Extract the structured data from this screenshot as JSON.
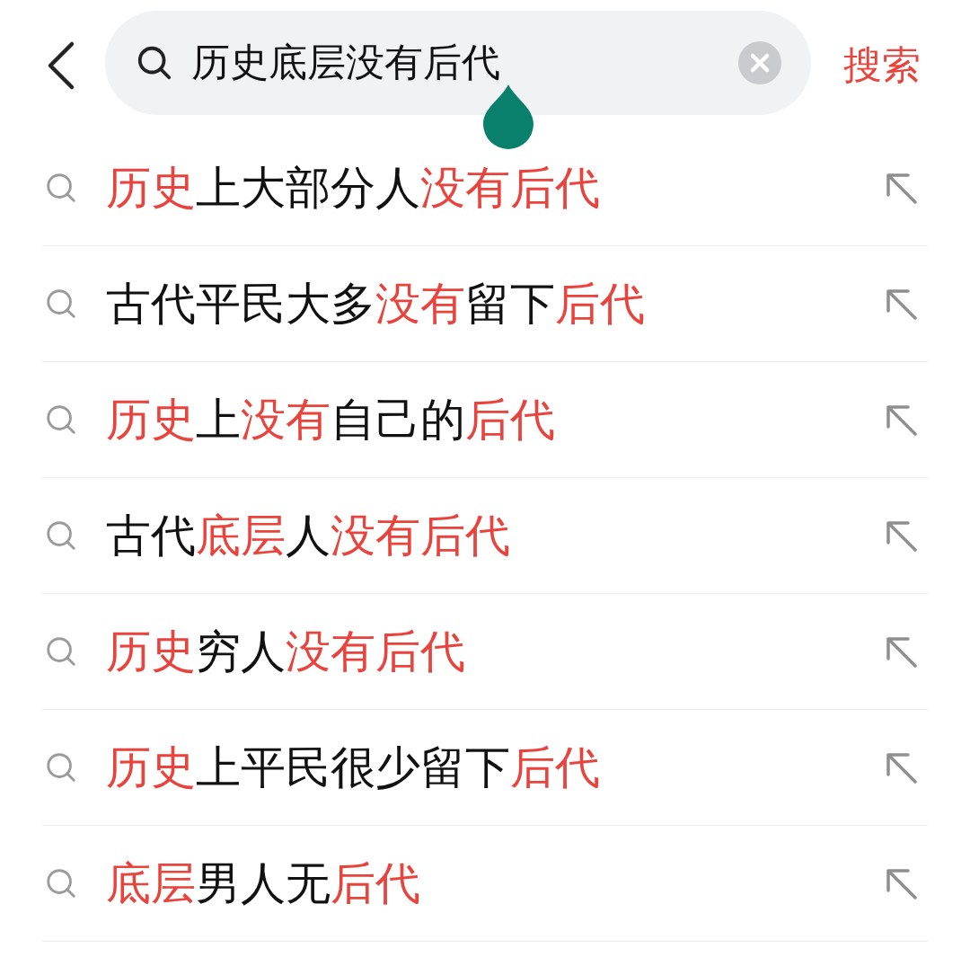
{
  "search": {
    "value": "历史底层没有后代",
    "submit": "搜索"
  },
  "suggestions": [
    {
      "segments": [
        {
          "text": "历史",
          "highlight": true
        },
        {
          "text": "上大部分人",
          "highlight": false
        },
        {
          "text": "没有后代",
          "highlight": true
        }
      ]
    },
    {
      "segments": [
        {
          "text": "古代平民大多",
          "highlight": false
        },
        {
          "text": "没有",
          "highlight": true
        },
        {
          "text": "留下",
          "highlight": false
        },
        {
          "text": "后代",
          "highlight": true
        }
      ]
    },
    {
      "segments": [
        {
          "text": "历史",
          "highlight": true
        },
        {
          "text": "上",
          "highlight": false
        },
        {
          "text": "没有",
          "highlight": true
        },
        {
          "text": "自己的",
          "highlight": false
        },
        {
          "text": "后代",
          "highlight": true
        }
      ]
    },
    {
      "segments": [
        {
          "text": "古代",
          "highlight": false
        },
        {
          "text": "底层",
          "highlight": true
        },
        {
          "text": "人",
          "highlight": false
        },
        {
          "text": "没有后代",
          "highlight": true
        }
      ]
    },
    {
      "segments": [
        {
          "text": "历史",
          "highlight": true
        },
        {
          "text": "穷人",
          "highlight": false
        },
        {
          "text": "没有后代",
          "highlight": true
        }
      ]
    },
    {
      "segments": [
        {
          "text": "历史",
          "highlight": true
        },
        {
          "text": "上平民很少留下",
          "highlight": false
        },
        {
          "text": "后代",
          "highlight": true
        }
      ]
    },
    {
      "segments": [
        {
          "text": "底层",
          "highlight": true
        },
        {
          "text": "男人无",
          "highlight": false
        },
        {
          "text": "后代",
          "highlight": true
        }
      ]
    }
  ]
}
